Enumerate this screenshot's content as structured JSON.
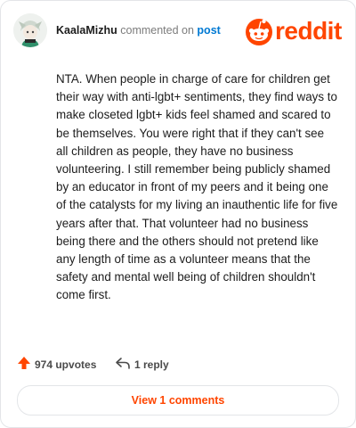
{
  "header": {
    "username": "KaalaMizhu",
    "action_text": "commented on",
    "link_text": "post",
    "brand": "reddit",
    "brand_color": "#ff4500",
    "link_color": "#0079d3"
  },
  "comment": {
    "text": "NTA. When people in charge of care for children get their way with anti-lgbt+ sentiments, they find ways to make closeted lgbt+ kids feel shamed and scared to be themselves. You were right that if they can't see all children as people, they have no business volunteering. I still remember being publicly shamed by an educator in front of my peers and it being one of the catalysts for my living an inauthentic life for five years after that. That volunteer had no business being there and the others should not pretend like any length of time as a volunteer means that the safety and mental well being of children shouldn't come first."
  },
  "actions": {
    "upvotes_label": "974 upvotes",
    "reply_label": "1 reply",
    "upvote_icon": "arrow-up-icon",
    "reply_icon": "reply-arrow-icon"
  },
  "footer": {
    "view_comments_label": "View 1 comments"
  }
}
